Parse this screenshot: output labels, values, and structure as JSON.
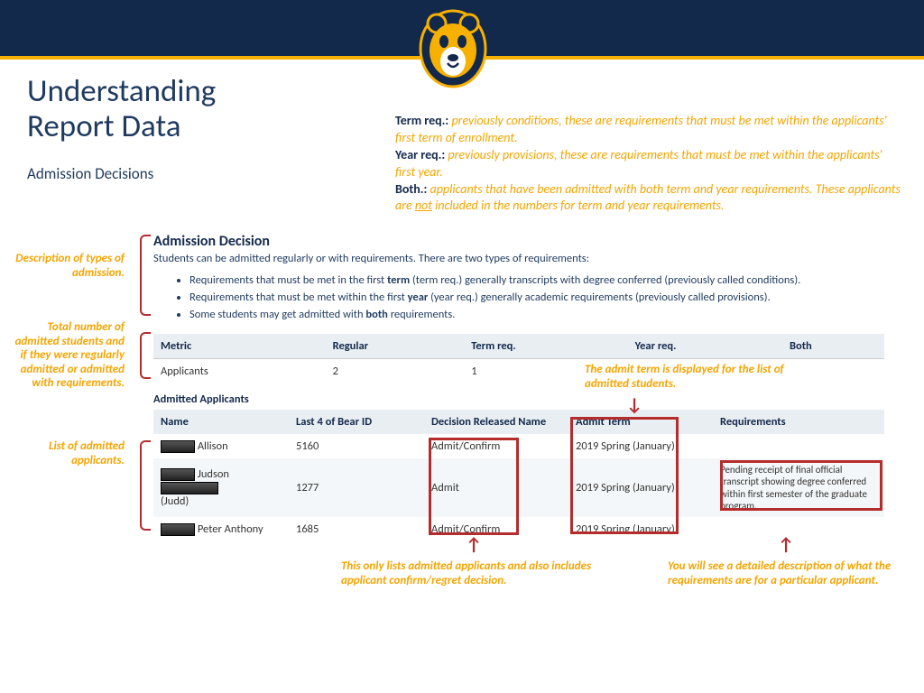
{
  "title_line1": "Understanding",
  "title_line2": "Report Data",
  "subtitle": "Admission Decisions",
  "glossary": {
    "term_label": "Term req.:",
    "term_text": " previously conditions, these are requirements that must be met within the applicants' first term of enrollment.",
    "year_label": "Year req.:",
    "year_text": " previously provisions, these are requirements that must be met within the applicants' first year.",
    "both_label": "Both.:",
    "both_text_a": " applicants that have been admitted with both term and year requirements. These applicants are ",
    "both_not": "not",
    "both_text_b": " included in the numbers for term and year requirements."
  },
  "report": {
    "heading": "Admission Decision",
    "intro": "Students can be admitted regularly or with requirements. There are two types of requirements:",
    "b1a": "Requirements that must be met in the first ",
    "b1b": "term",
    "b1c": " (term req.) generally transcripts with degree conferred (previously called conditions).",
    "b2a": "Requirements that must be met within the first ",
    "b2b": "year",
    "b2c": " (year req.) generally academic requirements (previously called provisions).",
    "b3a": "Some students may get admitted with ",
    "b3b": "both",
    "b3c": " requirements.",
    "metric_headers": {
      "c1": "Metric",
      "c2": "Regular",
      "c3": "Term req.",
      "c4": "Year req.",
      "c5": "Both"
    },
    "metric_row": {
      "label": "Applicants",
      "regular": "2",
      "term": "1",
      "year": "",
      "both": ""
    },
    "admitted_label": "Admitted Applicants",
    "app_headers": {
      "name": "Name",
      "id": "Last 4 of Bear ID",
      "decision": "Decision Released Name",
      "term": "Admit Term",
      "req": "Requirements"
    },
    "rows": [
      {
        "name": "Allison",
        "id": "5160",
        "decision": "Admit/Confirm",
        "term": "2019 Spring (January)",
        "req": ""
      },
      {
        "name": "Judson",
        "alias": "(Judd)",
        "id": "1277",
        "decision": "Admit",
        "term": "2019 Spring (January)",
        "req": "Pending receipt of final official transcript showing degree conferred within first semester of the graduate program."
      },
      {
        "name": "Peter Anthony",
        "id": "1685",
        "decision": "Admit/Confirm",
        "term": "2019 Spring (January)",
        "req": ""
      }
    ]
  },
  "annotations": {
    "desc": "Description of types of admission.",
    "total": "Total number of admitted students and if they were regularly admitted or admitted with requirements.",
    "list": "List of admitted applicants.",
    "admit_term": "The admit term is displayed for the list of admitted students.",
    "decision_note": "This only lists admitted applicants and also includes applicant confirm/regret decision.",
    "req_note": "You will see a detailed description of what the requirements are for a particular applicant."
  }
}
